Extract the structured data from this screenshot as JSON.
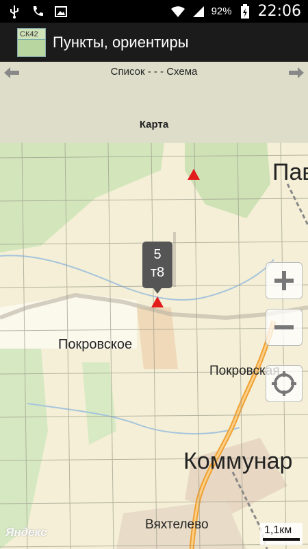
{
  "status_bar": {
    "icons": [
      "usb-icon",
      "phone-icon",
      "gallery-icon",
      "wifi-icon",
      "signal-icon",
      "battery-charging-icon"
    ],
    "battery": "92%",
    "time": "22:06"
  },
  "action_bar": {
    "app_icon_label": "СК42",
    "title": "Пункты, ориентиры"
  },
  "nav": {
    "links": "Список - - - Схема",
    "map_label": "Карта"
  },
  "map": {
    "places": {
      "pokrovskoe": "Покровское",
      "pokrovskaya": "Покровская",
      "kommunar": "Коммунар",
      "vyakhtelevo": "Вяхтелево",
      "pav": "Пав"
    },
    "callout": {
      "line1": "5",
      "line2": "т8"
    },
    "watermark": "Яндекс",
    "scale": "1,1км",
    "colors": {
      "marker": "#e21b1b",
      "road": "#f0a030",
      "forest": "#cfe2b8",
      "grid": "#9a9a8a"
    }
  }
}
